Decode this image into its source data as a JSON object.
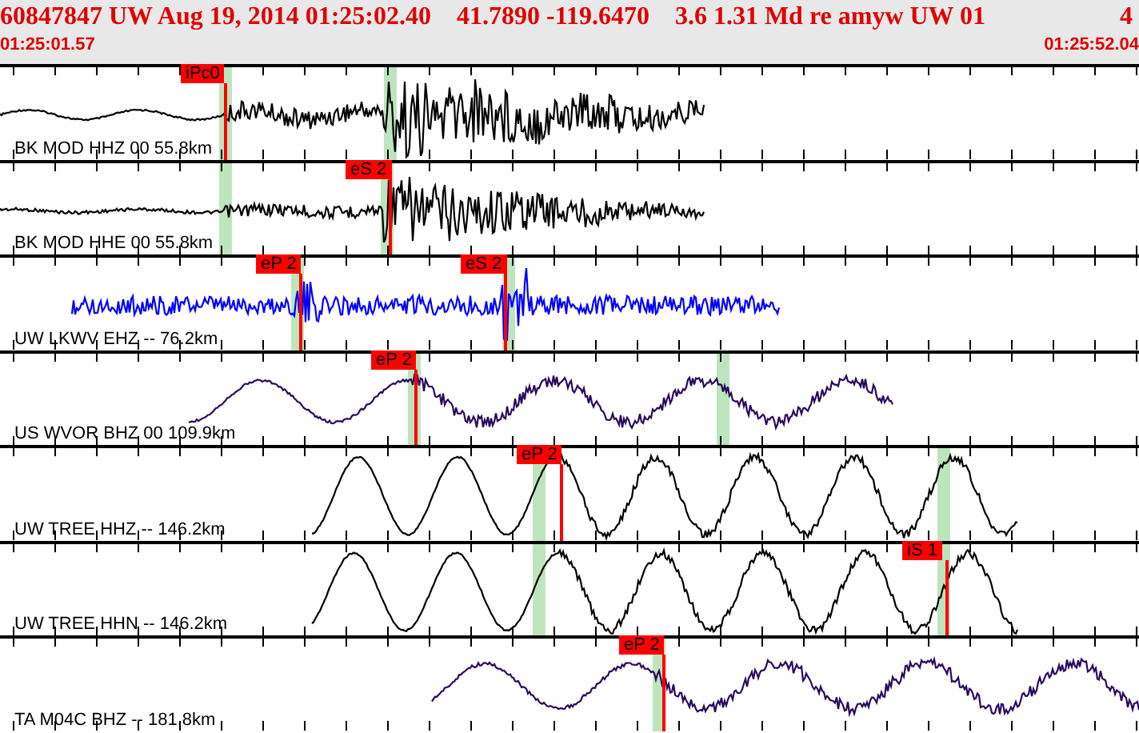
{
  "header": {
    "event": "60847847 UW Aug 19, 2014 01:25:02.40",
    "location": "41.7890 -119.6470",
    "magnitude": "3.6 1.31 Md re amyw UW 01",
    "count": "4"
  },
  "time_start": "01:25:01.57",
  "time_end": "01:25:52.04",
  "traces": [
    {
      "station": "BK MOD HHZ 00 55.8km",
      "color": "#000000",
      "picks": [
        {
          "label": "iPc0"
        }
      ]
    },
    {
      "station": "BK MOD HHE 00 55.8km",
      "color": "#000000",
      "picks": [
        {
          "label": "eS 2"
        }
      ]
    },
    {
      "station": "UW LKWV EHZ -- 76.2km",
      "color": "#0000ff",
      "picks": [
        {
          "label": "eP 2"
        },
        {
          "label": "eS 2"
        }
      ]
    },
    {
      "station": "US WVOR BHZ 00 109.9km",
      "color": "#2a0a5e",
      "picks": [
        {
          "label": "eP 2"
        }
      ]
    },
    {
      "station": "UW TREE HHZ -- 146.2km",
      "color": "#000000",
      "picks": [
        {
          "label": "eP 2"
        }
      ]
    },
    {
      "station": "UW TREE HHN -- 146.2km",
      "color": "#000000",
      "picks": [
        {
          "label": "iS 1"
        }
      ]
    },
    {
      "station": "TA M04C BHZ -- 181.8km",
      "color": "#2a0a5e",
      "picks": [
        {
          "label": "eP 2"
        }
      ]
    }
  ]
}
